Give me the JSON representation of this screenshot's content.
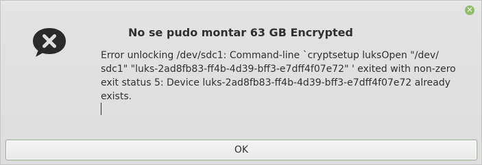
{
  "dialog": {
    "title": "No se pudo montar 63 GB Encrypted",
    "message": "Error unlocking /dev/sdc1: Command-line `cryptsetup luksOpen \"/dev/\nsdc1\" \"luks-2ad8fb83-ff4b-4d39-bff3-e7dff4f07e72\" ' exited with non-zero\nexit status 5: Device luks-2ad8fb83-ff4b-4d39-bff3-e7dff4f07e72 already\nexists.",
    "ok_label": "OK",
    "close_glyph": "✕"
  },
  "icons": {
    "error": "error-speech-bubble-icon",
    "close": "close-icon"
  },
  "colors": {
    "close_accent": "#8fbf6a",
    "icon_dark": "#2b2b2b",
    "focus_ring": "#c7dbb8"
  }
}
